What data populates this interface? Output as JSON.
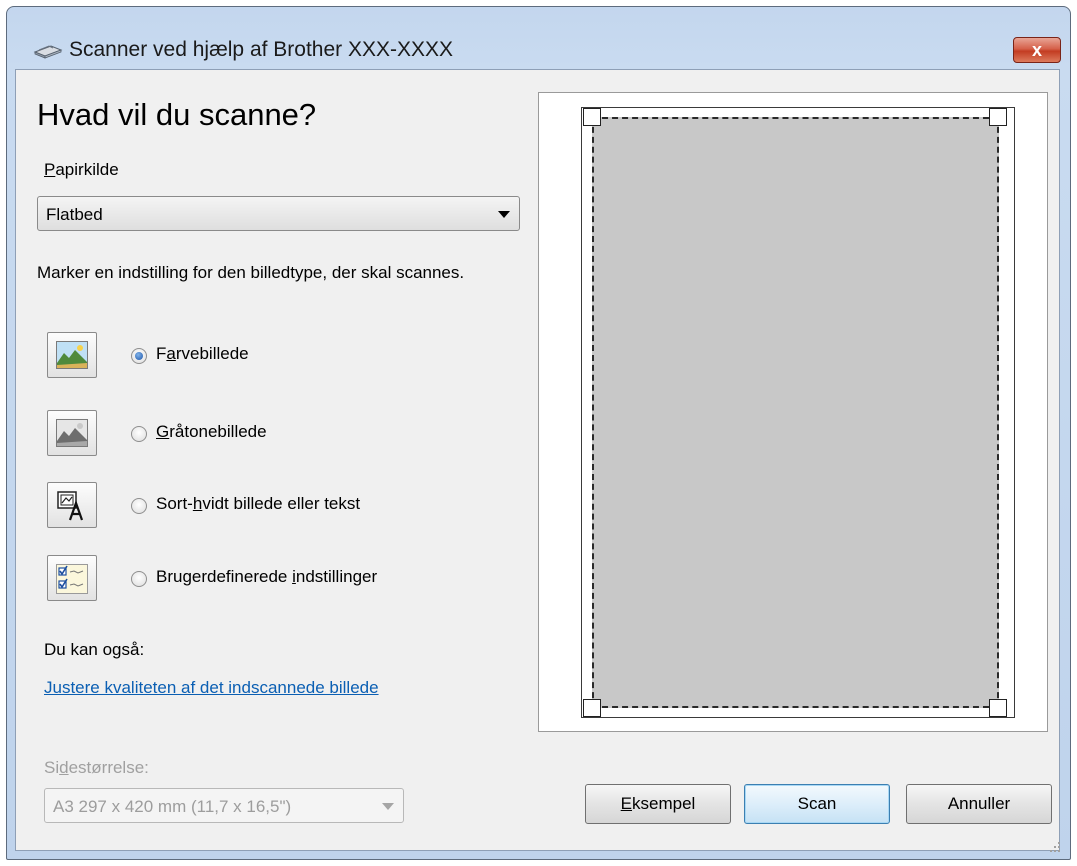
{
  "window": {
    "title": "Scanner ved hjælp af Brother XXX-XXXX",
    "close_label": "x"
  },
  "main": {
    "heading": "Hvad vil du scanne?",
    "paper_source": {
      "label_first": "P",
      "label_rest": "apirkilde",
      "value": "Flatbed"
    },
    "description": "Marker en indstilling for den billedtype, der skal scannes.",
    "options": [
      {
        "pre": "F",
        "u": "a",
        "post": "rvebillede",
        "selected": true,
        "icon": "color-picture-icon"
      },
      {
        "pre": "",
        "u": "G",
        "post": "råtonebillede",
        "selected": false,
        "icon": "grayscale-picture-icon"
      },
      {
        "pre": "Sort-",
        "u": "h",
        "post": "vidt billede eller tekst",
        "selected": false,
        "icon": "black-white-text-icon"
      },
      {
        "pre": "Brugerdefinerede ",
        "u": "i",
        "post": "ndstillinger",
        "selected": false,
        "icon": "custom-settings-icon"
      }
    ],
    "also_label": "Du kan også:",
    "adjust_link": "Justere kvaliteten af det indscannede billede",
    "page_size": {
      "label_pre": "Si",
      "label_u": "d",
      "label_post": "estørrelse:",
      "value": "A3 297 x 420 mm (11,7 x 16,5\")"
    }
  },
  "buttons": {
    "preview_u": "E",
    "preview_rest": "ksempel",
    "scan": "Scan",
    "cancel": "Annuller"
  },
  "colors": {
    "title_gradient": "#c3d6ee",
    "client_bg": "#f0f0f0",
    "link": "#0b5fb3",
    "scan_area": "#c8c8c8"
  }
}
